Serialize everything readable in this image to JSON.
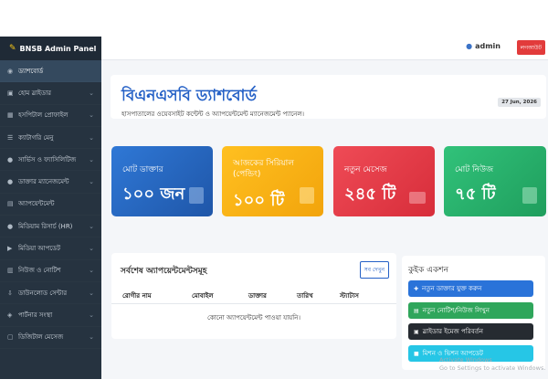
{
  "topbar": {
    "admin_label": "admin",
    "logout_label": "লগআউট"
  },
  "sidebar": {
    "brand": "BNSB Admin Panel",
    "items": [
      {
        "label": "ড্যাশবোর্ড",
        "icon": "gauge-icon"
      },
      {
        "label": "হোম স্লাইডার",
        "icon": "images-icon"
      },
      {
        "label": "হসপিটাল প্রোফাইল",
        "icon": "hospital-icon"
      },
      {
        "label": "ক্যাটাগরি মেনু",
        "icon": "list-icon"
      },
      {
        "label": "সার্ভিস ও ফ্যাসিলিটিজ",
        "icon": "user-icon"
      },
      {
        "label": "ডাক্তার ম্যানেজমেন্ট",
        "icon": "doctor-icon"
      },
      {
        "label": "অ্যাপয়েন্টমেন্ট",
        "icon": "calendar-icon"
      },
      {
        "label": "মিডিয়াম রিসার্চ (HR)",
        "icon": "user-icon"
      },
      {
        "label": "মিডিয়া আপডেট",
        "icon": "media-icon"
      },
      {
        "label": "নিউজ ও নোটিশ",
        "icon": "news-icon"
      },
      {
        "label": "ডাউনলোড সেন্টার",
        "icon": "download-icon"
      },
      {
        "label": "পার্টনার সংস্থা",
        "icon": "handshake-icon"
      },
      {
        "label": "ডিজিটাল মেসেজ",
        "icon": "message-icon"
      }
    ]
  },
  "dashboard": {
    "title": "বিএনএসবি ড্যাশবোর্ড",
    "subtitle": "হাসপাতালের ওয়েবসাইট কন্টেন্ট ও অ্যাপয়েন্টমেন্ট ম্যানেজমেন্ট প্যানেল।",
    "date": "27 Jun, 2026"
  },
  "stats": [
    {
      "label": "মোট ডাক্তার",
      "value": "১০০ জন",
      "icon": "stethoscope-icon"
    },
    {
      "label": "আজকের সিরিয়াল (পেন্ডিং)",
      "value": "১০০ টি",
      "icon": "calendar-icon"
    },
    {
      "label": "নতুন মেসেজ",
      "value": "২৪৫ টি",
      "icon": "envelope-icon"
    },
    {
      "label": "মোট নিউজ",
      "value": "৭৫ টি",
      "icon": "newspaper-icon"
    }
  ],
  "appointments": {
    "title": "সর্বশেষ অ্যাপয়েন্টমেন্টসমূহ",
    "see_all": "সব দেখুন",
    "columns": [
      "রোগীর নাম",
      "মোবাইল",
      "ডাক্তার",
      "তারিখ",
      "স্ট্যাটাস"
    ],
    "empty": "কোনো অ্যাপয়েন্টমেন্ট পাওয়া যায়নি।"
  },
  "quick_actions": {
    "title": "কুইক একশন",
    "buttons": [
      {
        "label": "নতুন ডাক্তার যুক্ত করুন",
        "icon": "plus-icon"
      },
      {
        "label": "নতুন নোটিশ/নিউজ লিখুন",
        "icon": "document-icon"
      },
      {
        "label": "স্লাইডার ইমেজ পরিবর্তন",
        "icon": "image-icon"
      },
      {
        "label": "মিশন ও ভিশন আপডেট",
        "icon": "flag-icon"
      }
    ]
  },
  "watermark": {
    "line1": "Activate Windows",
    "line2": "Go to Settings to activate Windows."
  }
}
